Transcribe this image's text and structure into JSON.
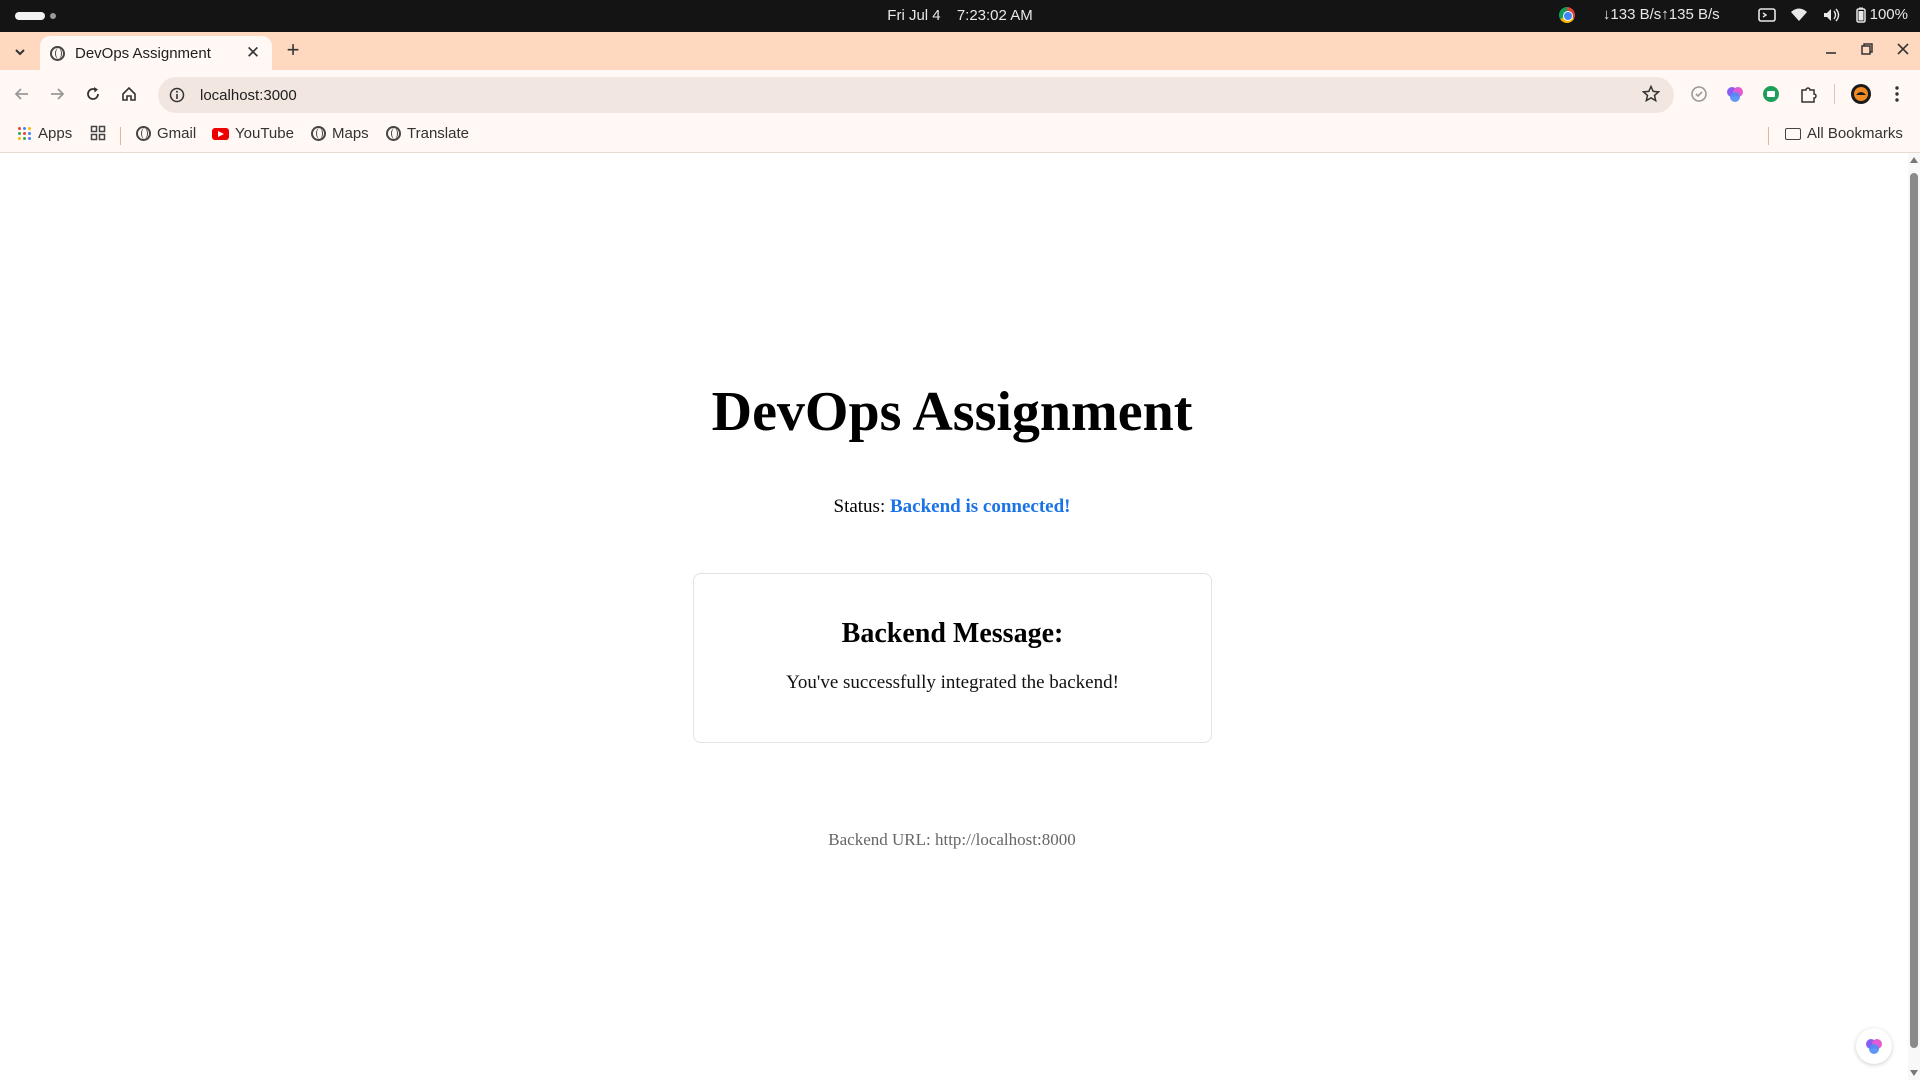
{
  "os_bar": {
    "date": "Fri Jul 4",
    "time": "7:23:02 AM",
    "network_speed": "↓133 B/s↑135 B/s",
    "battery": "100%"
  },
  "browser": {
    "tab": {
      "title": "DevOps Assignment"
    },
    "address": {
      "url": "localhost:3000"
    },
    "bookmarks": [
      {
        "label": "Apps"
      },
      {
        "label": "Gmail"
      },
      {
        "label": "YouTube"
      },
      {
        "label": "Maps"
      },
      {
        "label": "Translate"
      }
    ],
    "all_bookmarks_label": "All Bookmarks"
  },
  "page": {
    "title": "DevOps Assignment",
    "status_label": "Status:",
    "status_value": "Backend is connected!",
    "card_title": "Backend Message:",
    "card_message": "You've successfully integrated the backend!",
    "backend_url": "Backend URL: http://localhost:8000"
  },
  "colors": {
    "tab_strip": "#fed9c0",
    "status_accent": "#1a73e8"
  },
  "icons": [
    "tab-search-icon",
    "globe-icon",
    "close-icon",
    "plus-icon",
    "back-icon",
    "forward-icon",
    "reload-icon",
    "home-icon",
    "info-icon",
    "star-icon",
    "extension-icon",
    "profile-avatar",
    "menu-icon",
    "folder-icon",
    "youtube-icon",
    "apps-grid-icon"
  ]
}
